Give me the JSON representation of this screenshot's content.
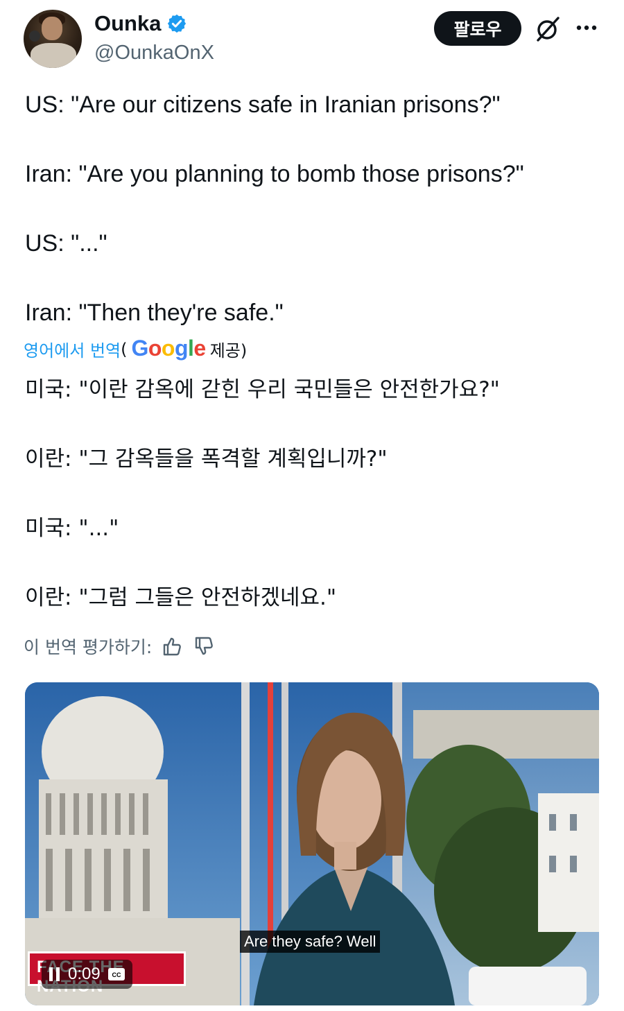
{
  "author": {
    "name": "Ounka",
    "handle": "@OunkaOnX",
    "verified": true
  },
  "actions": {
    "follow_label": "팔로우"
  },
  "tweet": {
    "lines": [
      "US: \"Are our citizens safe in Iranian prisons?\"",
      "Iran: \"Are you planning to bomb those prisons?\"",
      "US: \"...\"",
      "Iran: \"Then they're safe.\""
    ]
  },
  "translation": {
    "from_label": "영어에서 번역",
    "open_paren": "(",
    "provider": "Google",
    "provided_label": "제공)",
    "lines": [
      "미국: \"이란 감옥에 갇힌 우리 국민들은 안전한가요?\"",
      "이란: \"그 감옥들을 폭격할 계획입니까?\"",
      "미국: \"...\"",
      "이란: \"그럼 그들은 안전하겠네요.\""
    ],
    "rate_label": "이 번역 평가하기:"
  },
  "video": {
    "caption": "Are they safe? Well",
    "time": "0:09",
    "cc_label": "CC",
    "show_brand": "FACE THE NATION"
  },
  "colors": {
    "accent_blue": "#1d9bf0",
    "text": "#0f1419",
    "muted": "#536471",
    "brand_red": "#c8102e"
  },
  "icons": [
    "verified-badge-icon",
    "grok-icon",
    "more-icon",
    "thumbs-up-icon",
    "thumbs-down-icon",
    "pause-icon",
    "cc-icon"
  ]
}
